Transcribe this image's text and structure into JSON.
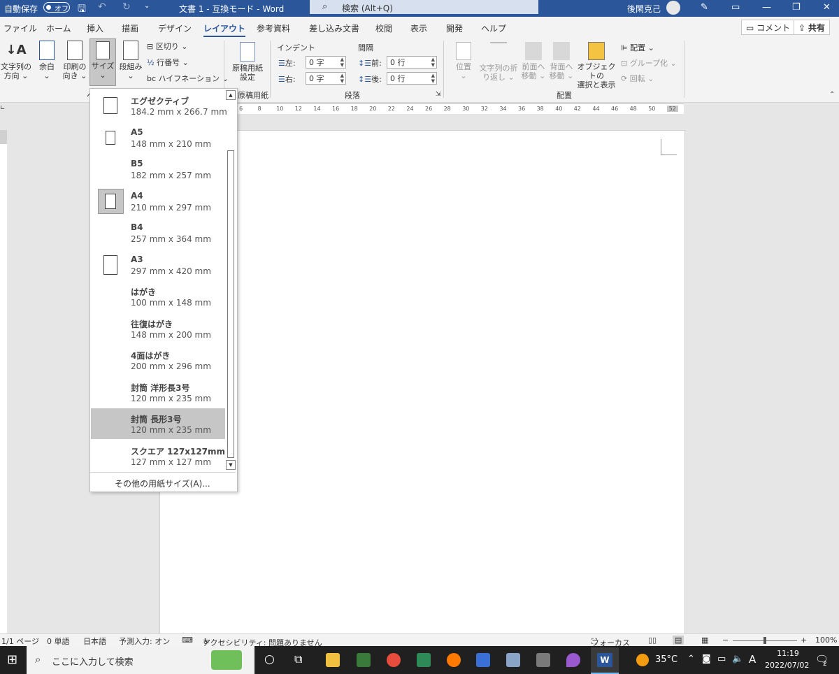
{
  "titlebar": {
    "autosave_label": "自動保存",
    "autosave_state": "オフ",
    "doc_title": "文書 1  -  互換モード  -  Word",
    "search_placeholder": "検索 (Alt+Q)",
    "user_name": "後閑克己"
  },
  "tabs": [
    "ファイル",
    "ホーム",
    "挿入",
    "描画",
    "デザイン",
    "レイアウト",
    "参考資料",
    "差し込み文書",
    "校閲",
    "表示",
    "開発",
    "ヘルプ"
  ],
  "active_tab": "レイアウト",
  "top_buttons": {
    "comment": "コメント",
    "share": "共有"
  },
  "ribbon": {
    "text_direction": [
      "文字列の",
      "方向 ⌄"
    ],
    "margins": [
      "余白",
      "⌄"
    ],
    "orientation": [
      "印刷の",
      "向き ⌄"
    ],
    "size": [
      "サイズ",
      "⌄"
    ],
    "columns": [
      "段組み",
      "⌄"
    ],
    "breaks": "区切り ⌄",
    "line_numbers": "行番号 ⌄",
    "hyphenation": "ハイフネーション ⌄",
    "manuscript": [
      "原稿用紙",
      "設定"
    ],
    "manuscript_group": "原稿用紙",
    "indent_label": "インデント",
    "spacing_label": "間隔",
    "indent_left_label": "左:",
    "indent_left_value": "0 字",
    "indent_right_label": "右:",
    "indent_right_value": "0 字",
    "spacing_before_label": "前:",
    "spacing_before_value": "0 行",
    "spacing_after_label": "後:",
    "spacing_after_value": "0 行",
    "paragraph_group": "段落",
    "position": [
      "位置",
      "⌄"
    ],
    "wrap_text": [
      "文字列の折",
      "り返し ⌄"
    ],
    "bring_forward": [
      "前面へ",
      "移動 ⌄"
    ],
    "send_backward": [
      "背面へ",
      "移動 ⌄"
    ],
    "selection_pane": [
      "オブジェクトの",
      "選択と表示"
    ],
    "align": "配置 ⌄",
    "group": "グループ化 ⌄",
    "rotate": "回転 ⌄",
    "arrange_group": "配置",
    "partial_group_label": "ペ"
  },
  "ruler_numbers": [
    "6",
    "8",
    "10",
    "12",
    "14",
    "16",
    "18",
    "20",
    "22",
    "24",
    "26",
    "28",
    "30",
    "32",
    "34",
    "36",
    "38",
    "40",
    "42",
    "44",
    "46",
    "48",
    "50",
    "52"
  ],
  "paper_sizes": [
    {
      "name": "エグゼクティブ",
      "size": "184.2 mm x 266.7 mm"
    },
    {
      "name": "A5",
      "size": "148 mm x 210 mm"
    },
    {
      "name": "B5",
      "size": "182 mm x 257 mm"
    },
    {
      "name": "A4",
      "size": "210 mm x 297 mm"
    },
    {
      "name": "B4",
      "size": "257 mm x 364 mm"
    },
    {
      "name": "A3",
      "size": "297 mm x 420 mm"
    },
    {
      "name": "はがき",
      "size": "100 mm x 148 mm"
    },
    {
      "name": "往復はがき",
      "size": "148 mm x 200 mm"
    },
    {
      "name": "4面はがき",
      "size": "200 mm x 296 mm"
    },
    {
      "name": "封筒 洋形長3号",
      "size": "120 mm x 235 mm"
    },
    {
      "name": "封筒 長形3号",
      "size": "120 mm x 235 mm"
    },
    {
      "name": "スクエア 127x127mm",
      "size": "127 mm x 127 mm"
    }
  ],
  "more_sizes": "その他の用紙サイズ(A)...",
  "statusbar": {
    "page": "1/1 ページ",
    "words": "0 単語",
    "language": "日本語",
    "predictive": "予測入力: オン",
    "accessibility": "アクセシビリティ: 問題ありません",
    "focus": "フォーカス",
    "zoom": "100%"
  },
  "taskbar": {
    "search_placeholder": "ここに入力して検索",
    "temperature": "35°C",
    "ime": "A",
    "time": "11:19",
    "date": "2022/07/02",
    "notification_count": "2"
  },
  "colors": {
    "accent": "#2b579a",
    "selected_item": "#c6c6c6"
  }
}
